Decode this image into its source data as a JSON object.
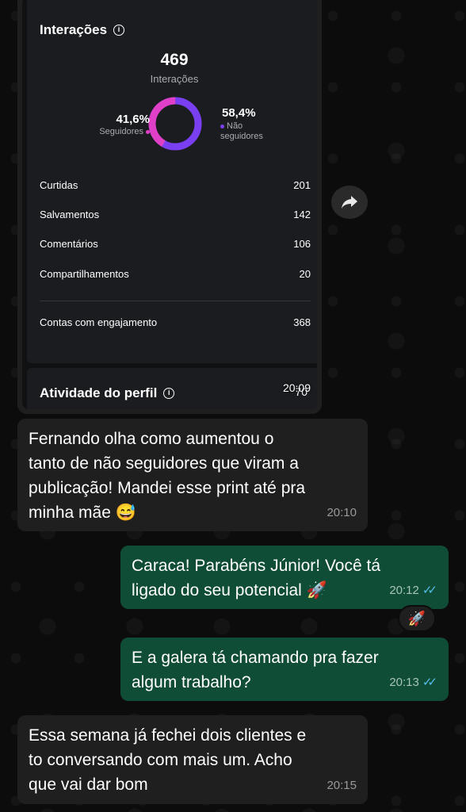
{
  "insights": {
    "section_title": "Interações",
    "total": "469",
    "total_label": "Interações",
    "followers_pct": "41,6%",
    "followers_label": "Seguidores",
    "non_followers_pct": "58,4%",
    "non_followers_label_1": "Não",
    "non_followers_label_2": "seguidores",
    "followers_share": 0.416,
    "colors": {
      "followers": "#e040c8",
      "non_followers": "#7b3ff2"
    },
    "metrics": [
      {
        "label": "Curtidas",
        "value": "201"
      },
      {
        "label": "Salvamentos",
        "value": "142"
      },
      {
        "label": "Comentários",
        "value": "106"
      },
      {
        "label": "Compartilhamentos",
        "value": "20"
      }
    ],
    "engagement": {
      "label": "Contas com engajamento",
      "value": "368"
    },
    "activity_title": "Atividade do perfil",
    "activity_value": "70",
    "image_time": "20:09"
  },
  "messages": [
    {
      "dir": "in",
      "text_lines": [
        "Fernando olha como aumentou o",
        "tanto de não seguidores que viram a",
        "publicação! Mandei esse print até pra",
        "minha mãe 😅"
      ],
      "time": "20:10"
    },
    {
      "dir": "out",
      "text_lines": [
        "Caraca! Parabéns Júnior! Você tá",
        "ligado do seu potencial 🚀"
      ],
      "time": "20:12",
      "reaction": "🚀"
    },
    {
      "dir": "out",
      "text_lines": [
        "E a galera tá chamando pra fazer",
        "algum trabalho?"
      ],
      "time": "20:13"
    },
    {
      "dir": "in",
      "text_lines": [
        "Essa semana já fechei dois clientes e",
        "to conversando com mais um. Acho",
        "que vai dar bom"
      ],
      "time": "20:15"
    }
  ],
  "icons": {
    "forward": "forward-arrow-icon",
    "info": "info-icon",
    "read": "double-check-icon"
  }
}
